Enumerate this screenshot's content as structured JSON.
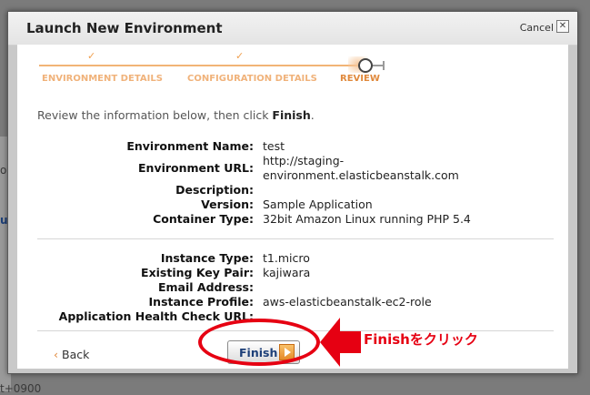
{
  "background": {
    "fragments": [
      "oli",
      "ur",
      "t+0900"
    ]
  },
  "dialog": {
    "title": "Launch New Environment",
    "cancel_label": "Cancel",
    "close_glyph": "✕"
  },
  "steps": [
    {
      "label": "ENVIRONMENT DETAILS",
      "state": "done"
    },
    {
      "label": "CONFIGURATION DETAILS",
      "state": "done"
    },
    {
      "label": "REVIEW",
      "state": "current"
    }
  ],
  "intro": {
    "prefix": "Review the information below, then click ",
    "emphasis": "Finish",
    "suffix": "."
  },
  "environment": [
    {
      "label": "Environment Name:",
      "value": "test"
    },
    {
      "label": "Environment URL:",
      "value": "http://staging-",
      "value2": "environment.elasticbeanstalk.com"
    },
    {
      "label": "Description:",
      "value": ""
    },
    {
      "label": "Version:",
      "value": "Sample Application"
    },
    {
      "label": "Container Type:",
      "value": "32bit Amazon Linux running PHP 5.4"
    }
  ],
  "instance": [
    {
      "label": "Instance Type:",
      "value": "t1.micro"
    },
    {
      "label": "Existing Key Pair:",
      "value": "kajiwara"
    },
    {
      "label": "Email Address:",
      "value": ""
    },
    {
      "label": "Instance Profile:",
      "value": "aws-elasticbeanstalk-ec2-role"
    },
    {
      "label": "Application Health Check URL:",
      "value": ""
    }
  ],
  "footer": {
    "back_label": "Back",
    "back_glyph": "‹",
    "finish_label": "Finish"
  },
  "annotation": {
    "text": "Finishをクリック",
    "color": "#e60012"
  }
}
